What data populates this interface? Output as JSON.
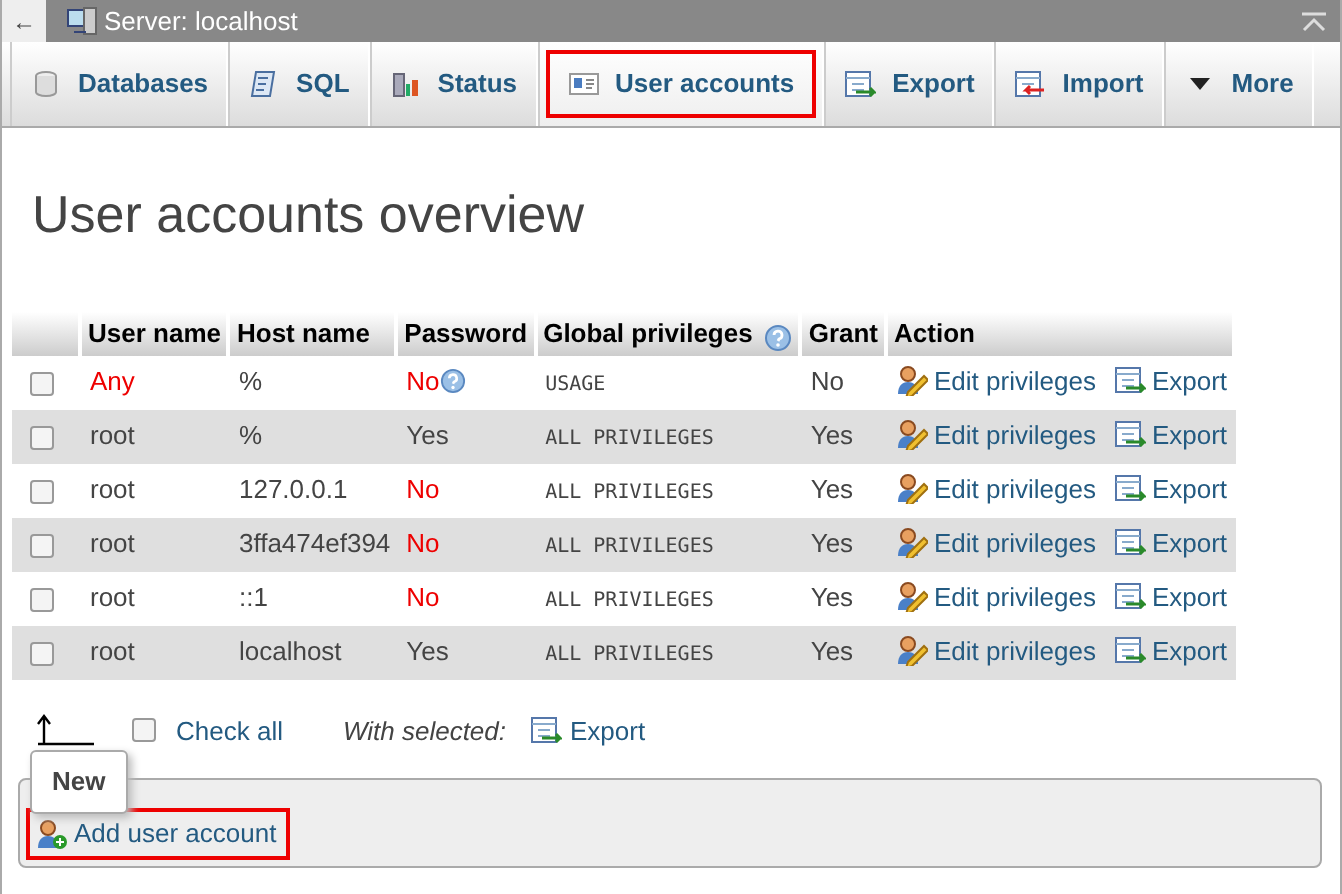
{
  "window": {
    "back": "←",
    "title": "Server: localhost"
  },
  "tabs": [
    {
      "label": "Databases",
      "selected": false
    },
    {
      "label": "SQL",
      "selected": false
    },
    {
      "label": "Status",
      "selected": false
    },
    {
      "label": "User accounts",
      "selected": true
    },
    {
      "label": "Export",
      "selected": false
    },
    {
      "label": "Import",
      "selected": false
    },
    {
      "label": "More",
      "selected": false
    }
  ],
  "heading": "User accounts overview",
  "table": {
    "columns": [
      "User name",
      "Host name",
      "Password",
      "Global privileges",
      "Grant",
      "Action"
    ],
    "rows": [
      {
        "checked": false,
        "user": "Any",
        "user_warning": true,
        "host": "%",
        "password": "No",
        "password_warning": true,
        "password_help": true,
        "privileges": "USAGE",
        "grant": "No",
        "edit": "Edit privileges",
        "export": "Export"
      },
      {
        "checked": false,
        "user": "root",
        "user_warning": false,
        "host": "%",
        "password": "Yes",
        "password_warning": false,
        "password_help": false,
        "privileges": "ALL PRIVILEGES",
        "grant": "Yes",
        "edit": "Edit privileges",
        "export": "Export"
      },
      {
        "checked": false,
        "user": "root",
        "user_warning": false,
        "host": "127.0.0.1",
        "password": "No",
        "password_warning": true,
        "password_help": false,
        "privileges": "ALL PRIVILEGES",
        "grant": "Yes",
        "edit": "Edit privileges",
        "export": "Export"
      },
      {
        "checked": false,
        "user": "root",
        "user_warning": false,
        "host": "3ffa474ef394",
        "password": "No",
        "password_warning": true,
        "password_help": false,
        "privileges": "ALL PRIVILEGES",
        "grant": "Yes",
        "edit": "Edit privileges",
        "export": "Export"
      },
      {
        "checked": false,
        "user": "root",
        "user_warning": false,
        "host": "::1",
        "password": "No",
        "password_warning": true,
        "password_help": false,
        "privileges": "ALL PRIVILEGES",
        "grant": "Yes",
        "edit": "Edit privileges",
        "export": "Export"
      },
      {
        "checked": false,
        "user": "root",
        "user_warning": false,
        "host": "localhost",
        "password": "Yes",
        "password_warning": false,
        "password_help": false,
        "privileges": "ALL PRIVILEGES",
        "grant": "Yes",
        "edit": "Edit privileges",
        "export": "Export"
      }
    ]
  },
  "bulk": {
    "check_all": "Check all",
    "checked": false,
    "with_selected": "With selected:",
    "export": "Export"
  },
  "new_section": {
    "legend": "New",
    "link": "Add user account",
    "highlighted": true
  }
}
